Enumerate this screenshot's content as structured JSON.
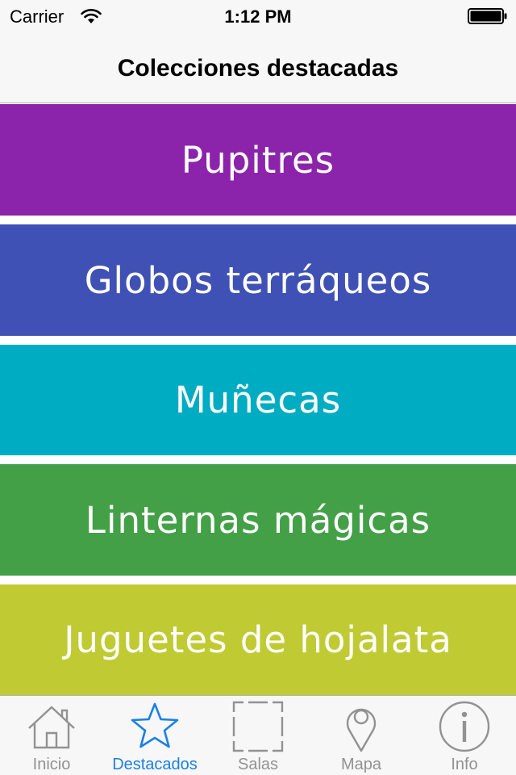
{
  "status_bar": {
    "carrier": "Carrier",
    "time": "1:12 PM"
  },
  "nav": {
    "title": "Colecciones destacadas"
  },
  "collections": [
    {
      "label": "Pupitres",
      "color": "#8b24ab"
    },
    {
      "label": "Globos terráqueos",
      "color": "#3f51b5"
    },
    {
      "label": "Muñecas",
      "color": "#00acc1"
    },
    {
      "label": "Linternas mágicas",
      "color": "#43a047"
    },
    {
      "label": "Juguetes de hojalata",
      "color": "#c0ca33"
    }
  ],
  "tabs": [
    {
      "label": "Inicio",
      "icon": "home-icon",
      "active": false
    },
    {
      "label": "Destacados",
      "icon": "star-icon",
      "active": true
    },
    {
      "label": "Salas",
      "icon": "rooms-icon",
      "active": false
    },
    {
      "label": "Mapa",
      "icon": "map-pin-icon",
      "active": false
    },
    {
      "label": "Info",
      "icon": "info-icon",
      "active": false
    }
  ],
  "colors": {
    "tab_active": "#1a80e6",
    "tab_inactive": "#929292",
    "bar_background": "#f7f7f7"
  }
}
